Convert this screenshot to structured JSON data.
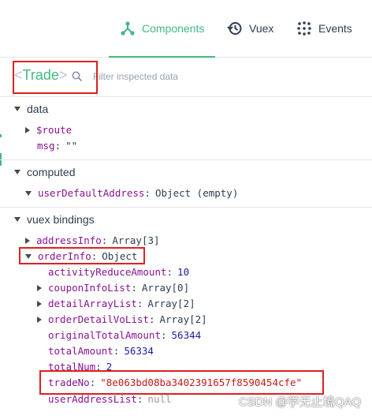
{
  "tabs": [
    {
      "label": "Components",
      "icon": "components-icon",
      "active": true
    },
    {
      "label": "Vuex",
      "icon": "history-icon",
      "active": false
    },
    {
      "label": "Events",
      "icon": "events-icon",
      "active": false
    }
  ],
  "inspector": {
    "component_name": "Trade",
    "bracket_open": "<",
    "bracket_close": ">",
    "filter_placeholder": "Filter inspected data"
  },
  "sections": {
    "data": {
      "title": "data",
      "props": [
        {
          "key": "$route",
          "expandable": true,
          "value": ""
        },
        {
          "key": "msg",
          "value": "\"\""
        }
      ]
    },
    "computed": {
      "title": "computed",
      "props": [
        {
          "key": "userDefaultAddress",
          "value": "Object (empty)"
        }
      ]
    },
    "vuex": {
      "title": "vuex bindings",
      "props": [
        {
          "key": "addressInfo",
          "value": "Array[3]"
        },
        {
          "key": "orderInfo",
          "value": "Object"
        },
        {
          "key": "activityReduceAmount",
          "value": "10"
        },
        {
          "key": "couponInfoList",
          "value": "Array[0]"
        },
        {
          "key": "detailArrayList",
          "value": "Array[2]"
        },
        {
          "key": "orderDetailVoList",
          "value": "Array[2]"
        },
        {
          "key": "originalTotalAmount",
          "value": "56344"
        },
        {
          "key": "totalAmount",
          "value": "56334"
        },
        {
          "key": "totalNum",
          "value": "2"
        },
        {
          "key": "tradeNo",
          "value": "\"8e063bd08ba3402391657f8590454cfe\""
        },
        {
          "key": "userAddressList",
          "value": "null"
        }
      ]
    }
  },
  "watermark": "CSDN @学无止境QAQ",
  "colors": {
    "accent": "#42b983",
    "highlight": "#e02020",
    "key": "#881391",
    "number": "#1a1aa6",
    "string": "#c41a16"
  }
}
